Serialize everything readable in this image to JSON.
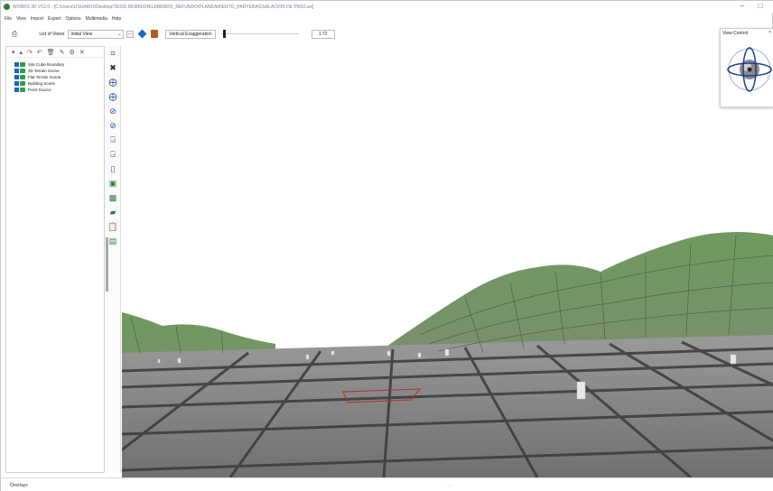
{
  "window": {
    "title": "WORKS 3D V13.0 - [C:\\Users\\USUARIO\\Desktop\\TESIS REMISION\\LABRADO_REFUNDO\\PLANEAMIENTO_PARYERAS\\SALACION DE PM10.wx]",
    "minimize_glyph": "–",
    "maximize_glyph": "□"
  },
  "menu": [
    "File",
    "View",
    "Import",
    "Export",
    "Options",
    "Multimedia",
    "Help"
  ],
  "toolbar": {
    "list_of_views_label": "List of Views",
    "selected_view": "Initial View",
    "vertical_exaggeration_label": "Vertical Exaggeration",
    "vertical_exaggeration_value": "1.72",
    "vertical_exaggeration_level": 0.03
  },
  "layers": {
    "items": [
      {
        "label": "Site Cube Boundary"
      },
      {
        "label": "3D Terrain Scene"
      },
      {
        "label": "Flat Terrain Scene"
      },
      {
        "label": "Building Scene"
      },
      {
        "label": "Point Source"
      }
    ]
  },
  "view_control": {
    "title": "View Control",
    "close_glyph": "×"
  },
  "status": {
    "left_text": "Overlays",
    "center_text": "…"
  },
  "colors": {
    "terrain_green": "#6f9a5e",
    "grid_dark": "#3c3c3c",
    "ground_gray": "#8a8a8a",
    "accent_blue": "#1565c0"
  }
}
